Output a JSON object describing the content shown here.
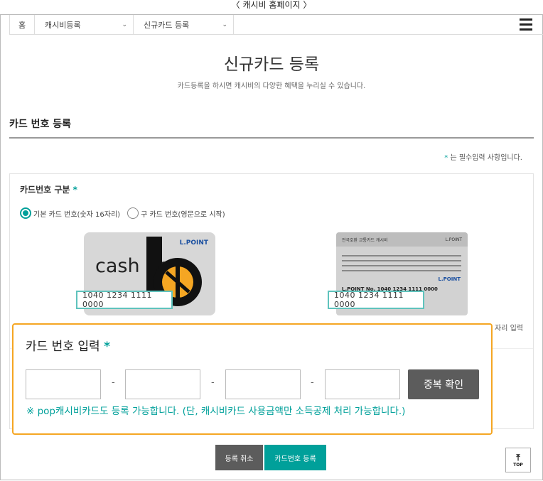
{
  "caption": "〈 캐시비 홈페이지 〉",
  "nav": {
    "home": "홈",
    "menu1": "캐시비등록",
    "menu2": "신규카드 등록"
  },
  "page": {
    "title": "신규카드 등록",
    "subtitle": "카드등록을 하시면 캐시비의 다양한 혜택을 누리실 수 있습니다."
  },
  "section": {
    "title": "카드 번호 등록",
    "required_star": "*",
    "required_note": "는 필수입력 사항입니다."
  },
  "card_type": {
    "label": "카드번호 구분",
    "options": [
      "기본 카드 번호(숫자 16자리)",
      "구 카드 번호(영문으로 시작)"
    ],
    "selected": 0
  },
  "sample_cards": {
    "card1_brand": "cash bee",
    "card1_logo": "L.POINT",
    "card1_number": "1040 1234 1111 0000",
    "card2_header_left": "전국호환 교통카드 캐시비",
    "card2_header_right": "L.POINT",
    "card2_logo": "L.POINT",
    "card2_printed": "L.POINT No. 1040 1234 1111 0000",
    "card2_number": "1040 1234 1111 0000",
    "cut_text": "자리 입력"
  },
  "card_input": {
    "title": "카드 번호 입력",
    "separator": "-",
    "dup_check": "중복 확인",
    "notice": "※ pop캐시비카드도 등록 가능합니다. (단, 캐시비카드 사용금액만 소득공제 처리 가능합니다.)"
  },
  "buttons": {
    "cancel": "등록 취소",
    "register": "카드번호 등록",
    "top": "TOP"
  }
}
